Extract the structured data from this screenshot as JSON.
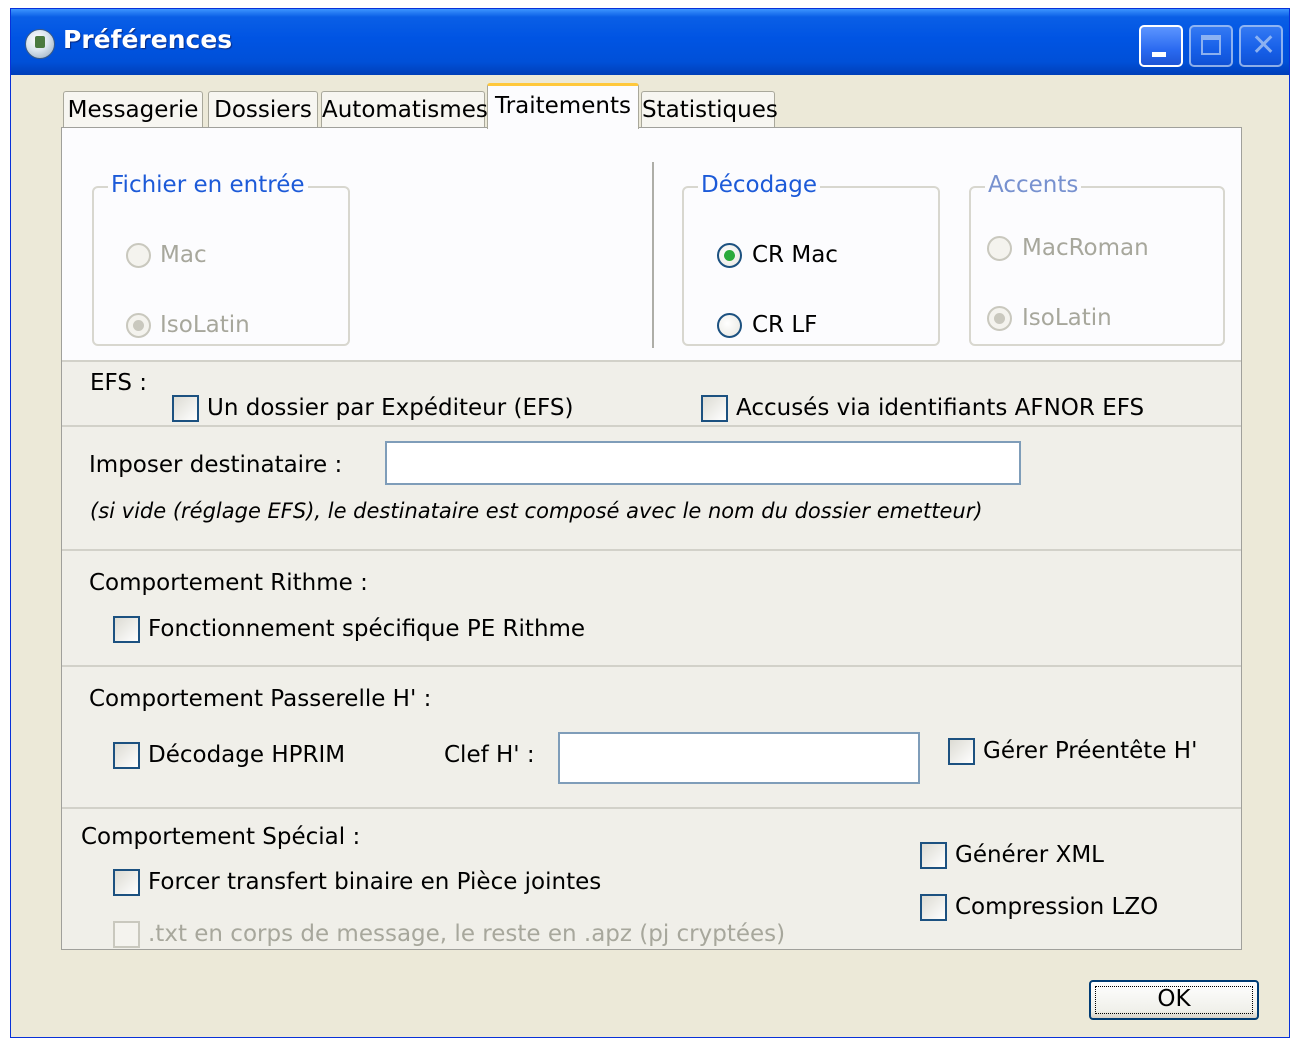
{
  "window": {
    "title": "Préférences"
  },
  "tabs": [
    {
      "label": "Messagerie",
      "active": false
    },
    {
      "label": "Dossiers",
      "active": false
    },
    {
      "label": "Automatismes",
      "active": false
    },
    {
      "label": "Traitements",
      "active": true
    },
    {
      "label": "Statistiques",
      "active": false
    }
  ],
  "fichier_entree": {
    "legend": "Fichier en entrée",
    "enabled": false,
    "options": [
      {
        "label": "Mac",
        "selected": false
      },
      {
        "label": "IsoLatin",
        "selected": true
      }
    ]
  },
  "decodage": {
    "legend": "Décodage",
    "enabled": true,
    "options": [
      {
        "label": "CR Mac",
        "selected": true
      },
      {
        "label": "CR LF",
        "selected": false
      }
    ]
  },
  "accents": {
    "legend": "Accents",
    "enabled": false,
    "options": [
      {
        "label": "MacRoman",
        "selected": false
      },
      {
        "label": "IsoLatin",
        "selected": true
      }
    ]
  },
  "efs": {
    "label": "EFS :",
    "dossier_par_expediteur": {
      "label": "Un dossier par Expéditeur (EFS)",
      "checked": false
    },
    "accuses_afnor": {
      "label": "Accusés via identifiants AFNOR EFS",
      "checked": false
    }
  },
  "destinataire": {
    "label": "Imposer destinataire :",
    "value": "",
    "hint": "(si vide (réglage EFS), le destinataire est composé avec le nom du dossier emetteur)"
  },
  "rithme": {
    "label": "Comportement Rithme :",
    "specifique": {
      "label": "Fonctionnement spécifique PE Rithme",
      "checked": false
    }
  },
  "passerelle": {
    "label": "Comportement Passerelle H' :",
    "decodage_hprim": {
      "label": "Décodage HPRIM",
      "checked": false
    },
    "clef_label": "Clef H' :",
    "clef_value": "",
    "preentete": {
      "label": "Gérer Préentête H'",
      "checked": false
    }
  },
  "special": {
    "label": "Comportement Spécial :",
    "forcer_binaire": {
      "label": "Forcer transfert binaire en Pièce jointes",
      "checked": false
    },
    "txt_corps": {
      "label": ".txt en corps de message, le reste en .apz (pj cryptées)",
      "checked": false,
      "enabled": false
    },
    "generer_xml": {
      "label": "Générer XML",
      "checked": false
    },
    "compression_lzo": {
      "label": "Compression LZO",
      "checked": false
    }
  },
  "footer": {
    "ok_label": "OK"
  }
}
